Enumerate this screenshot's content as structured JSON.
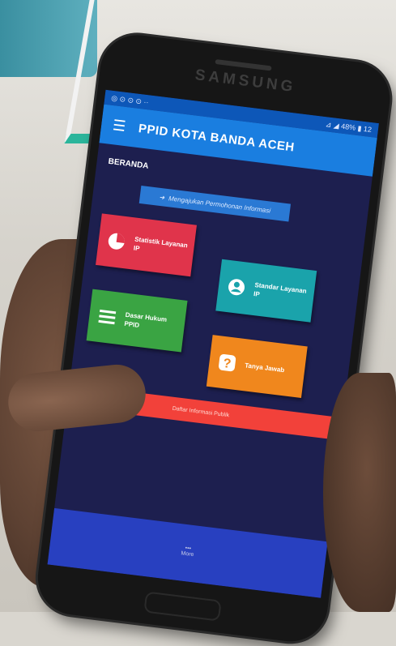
{
  "device": {
    "brand": "SAMSUNG"
  },
  "statusbar": {
    "left": "◎ ⊙ ⊙ ⊙ ··",
    "right": "⊿ ◢ 48% ▮ 12"
  },
  "appbar": {
    "title": "PPID KOTA BANDA ACEH",
    "menu_icon": "menu-icon"
  },
  "page": {
    "section_title": "BERANDA"
  },
  "request_button": {
    "label": "Mengajukan Permohonan Informasi",
    "icon": "arrow-right-icon"
  },
  "tiles": [
    {
      "label": "Statistik Layanan IP",
      "icon": "pie-chart-icon",
      "color": "#e0344b"
    },
    {
      "label": "Standar Layanan IP",
      "icon": "person-icon",
      "color": "#1aa3ab"
    },
    {
      "label": "Dasar Hukum PPID",
      "icon": "list-icon",
      "color": "#3aa443"
    },
    {
      "label": "Tanya Jawab",
      "icon": "question-icon",
      "color": "#f0871d"
    }
  ],
  "wide_button": {
    "label": "Daftar Informasi Publik",
    "color": "#f2413a"
  },
  "bottom": {
    "more_glyph": "•••",
    "more_label": "More"
  }
}
